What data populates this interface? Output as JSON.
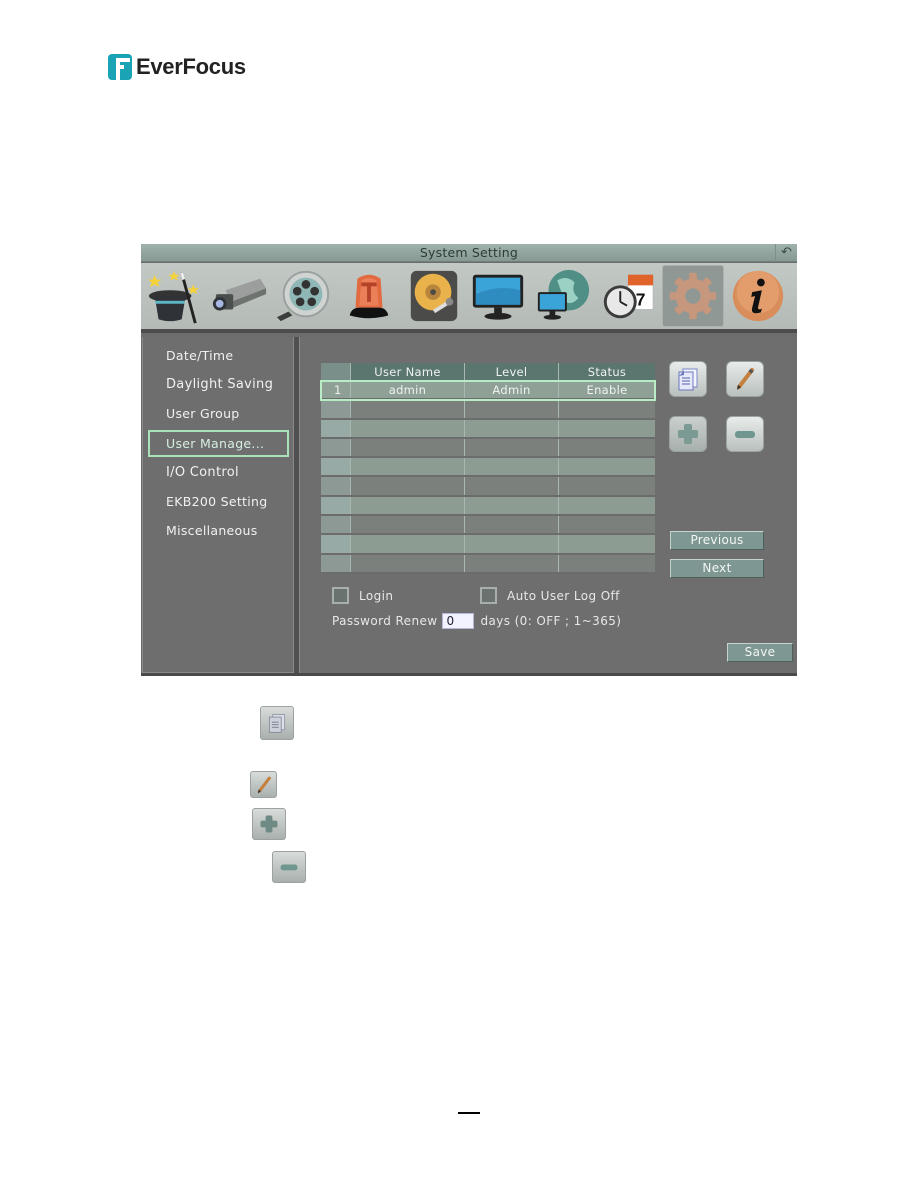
{
  "brand": {
    "name": "EverFocus",
    "color": "#1aa3b4"
  },
  "window": {
    "title": "System Setting",
    "back_icon": "return-arrow-icon"
  },
  "toolbar": {
    "icons": [
      {
        "name": "wizard-hat-icon",
        "label": "Wizard"
      },
      {
        "name": "camera-icon",
        "label": "Camera"
      },
      {
        "name": "record-reel-icon",
        "label": "Record"
      },
      {
        "name": "alarm-siren-icon",
        "label": "Alarm"
      },
      {
        "name": "hard-disk-icon",
        "label": "Disk"
      },
      {
        "name": "monitor-icon",
        "label": "Display"
      },
      {
        "name": "network-globe-icon",
        "label": "Network"
      },
      {
        "name": "schedule-clock-calendar-icon",
        "label": "Schedule"
      },
      {
        "name": "gear-icon",
        "label": "System",
        "active": true
      },
      {
        "name": "info-icon",
        "label": "Information"
      }
    ]
  },
  "sidebar": {
    "items": [
      {
        "label": "Date/Time"
      },
      {
        "label": "Daylight Saving"
      },
      {
        "label": "User Group"
      },
      {
        "label": "User Manage...",
        "selected": true
      },
      {
        "label": "I/O Control"
      },
      {
        "label": "EKB200 Setting"
      },
      {
        "label": "Miscellaneous"
      }
    ]
  },
  "user_table": {
    "columns": [
      "",
      "User Name",
      "Level",
      "Status"
    ],
    "rows": [
      {
        "index": "1",
        "user_name": "admin",
        "level": "Admin",
        "status": "Enable",
        "selected": true
      }
    ],
    "empty_rows": 9
  },
  "actions": {
    "copy_icon": "copy-document-icon",
    "edit_icon": "pencil-edit-icon",
    "add_icon": "plus-add-icon",
    "remove_icon": "minus-remove-icon",
    "previous_label": "Previous",
    "next_label": "Next",
    "save_label": "Save"
  },
  "options": {
    "login_label": "Login",
    "login_checked": false,
    "auto_logoff_label": "Auto User Log Off",
    "auto_logoff_checked": false,
    "password_renew_label": "Password Renew",
    "password_renew_value": "0",
    "password_renew_unit": "days (0: OFF ; 1~365)"
  },
  "colors": {
    "panel_bg": "#6e6e6e",
    "selection_outline": "#a9e2b8",
    "table_header": "#5b756f",
    "button_bg": "#7f9792"
  }
}
